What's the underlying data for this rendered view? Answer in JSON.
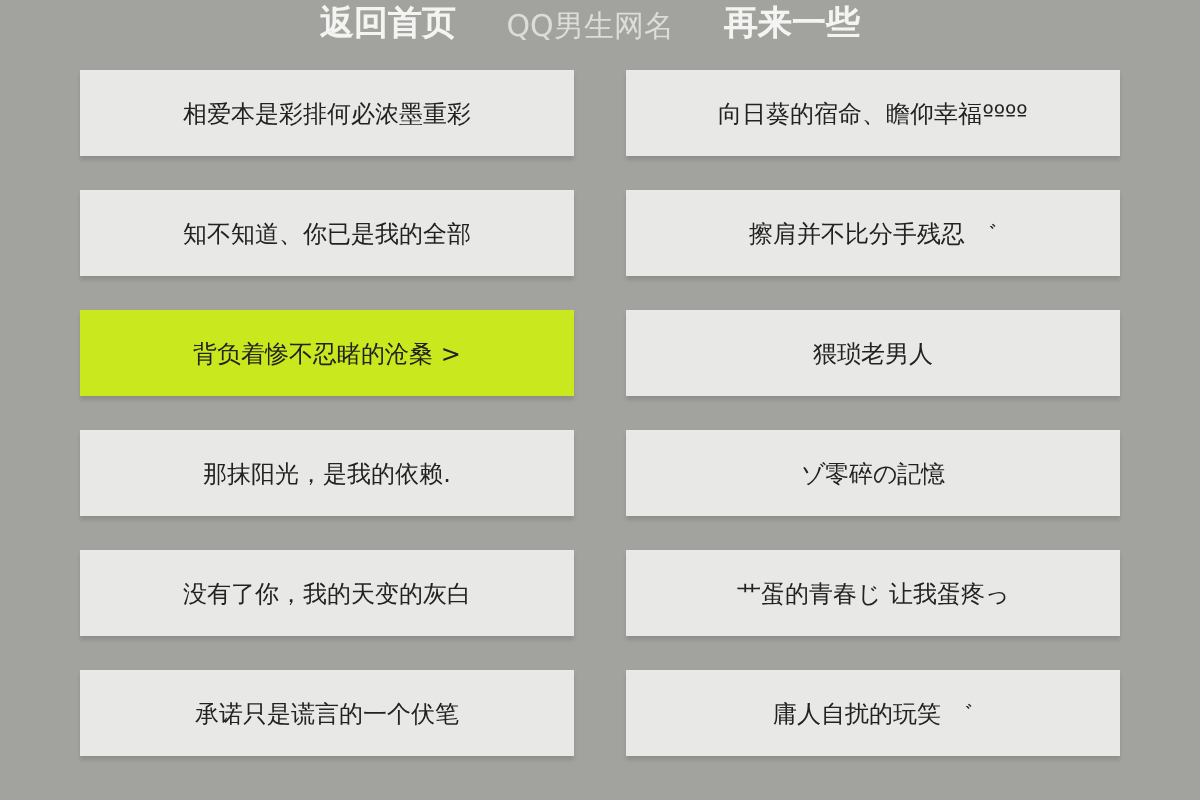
{
  "header": {
    "back_link": "返回首页",
    "title": "QQ男生网名",
    "more_link": "再来一些"
  },
  "names": [
    {
      "text": "相爱本是彩排何必浓墨重彩",
      "selected": false
    },
    {
      "text": "向日葵的宿命、瞻仰幸福ºººº",
      "selected": false
    },
    {
      "text": "知不知道、你已是我的全部",
      "selected": false
    },
    {
      "text": "擦肩并不比分手残忍 ゛",
      "selected": false
    },
    {
      "text": "背负着惨不忍睹的沧桑 >",
      "selected": true
    },
    {
      "text": "猥琐老男人",
      "selected": false
    },
    {
      "text": "那抹阳光，是我的依赖.",
      "selected": false
    },
    {
      "text": "ゾ零碎の記憶",
      "selected": false
    },
    {
      "text": "没有了你，我的天变的灰白",
      "selected": false
    },
    {
      "text": "艹蛋的青春じ 让我蛋疼っ",
      "selected": false
    },
    {
      "text": "承诺只是谎言的一个伏笔",
      "selected": false
    },
    {
      "text": "庸人自扰的玩笑 ゛",
      "selected": false
    }
  ]
}
